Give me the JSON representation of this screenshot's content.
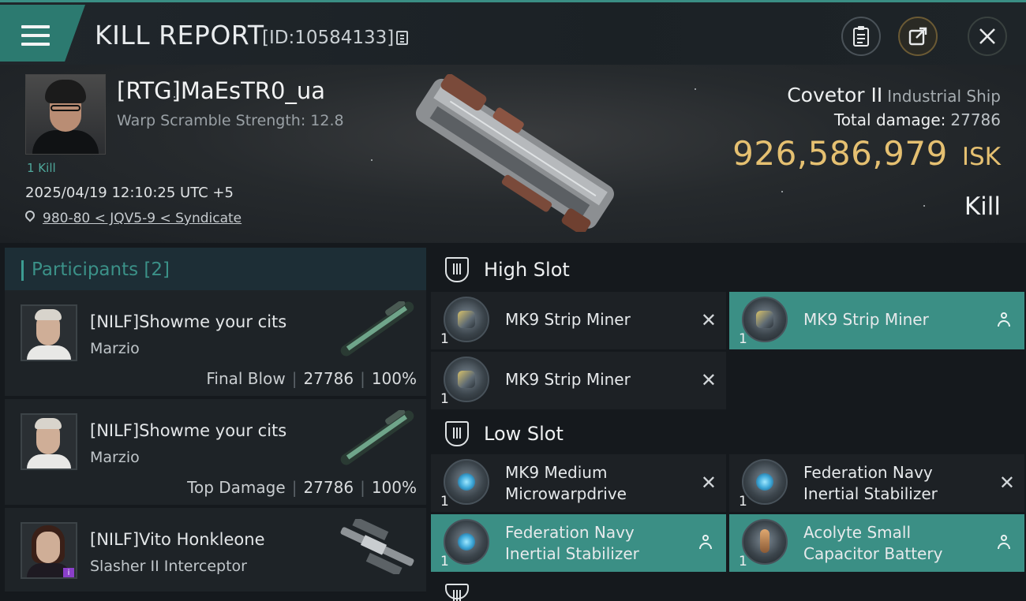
{
  "header": {
    "title": "KILL REPORT",
    "report_id": "[ID:10584133]",
    "menu_icon": "hamburger-icon",
    "buttons": [
      {
        "name": "clipboard-button",
        "icon": "clipboard-icon"
      },
      {
        "name": "share-button",
        "icon": "share-icon"
      },
      {
        "name": "close-button",
        "icon": "close-icon"
      }
    ]
  },
  "victim": {
    "pilot_name": "[RTG]MaEsTR0_ua",
    "warp_scramble": "Warp Scramble Strength: 12.8",
    "kills": "1 Kill",
    "datetime": "2025/04/19 12:10:25 UTC +5",
    "location": "980-80 < JQV5-9 < Syndicate",
    "ship_name": "Covetor II",
    "ship_class": "Industrial Ship",
    "total_damage_label": "Total damage:",
    "total_damage": "27786",
    "isk_value": "926,586,979",
    "isk_currency": "ISK",
    "result": "Kill"
  },
  "participants": {
    "header": "Participants",
    "count": "[2]",
    "rows": [
      {
        "name": "[NILF]Showme your cits",
        "sub": "Marzio",
        "label": "Final Blow",
        "damage": "27786",
        "percent": "100%"
      },
      {
        "name": "[NILF]Showme your cits",
        "sub": "Marzio",
        "label": "Top Damage",
        "damage": "27786",
        "percent": "100%"
      },
      {
        "name": "[NILF]Vito Honkleone",
        "sub": "Slasher II Interceptor",
        "badge": "i"
      }
    ]
  },
  "slots": {
    "high": {
      "title": "High Slot",
      "modules": [
        {
          "name": "MK9 Strip Miner",
          "qty": "1",
          "status": "destroyed"
        },
        {
          "name": "MK9 Strip Miner",
          "qty": "1",
          "status": "dropped"
        },
        {
          "name": "MK9 Strip Miner",
          "qty": "1",
          "status": "destroyed"
        }
      ]
    },
    "low": {
      "title": "Low Slot",
      "modules": [
        {
          "name_line1": "MK9 Medium",
          "name_line2": "Microwarpdrive",
          "qty": "1",
          "status": "destroyed"
        },
        {
          "name_line1": "Federation Navy",
          "name_line2": "Inertial Stabilizer",
          "qty": "1",
          "status": "destroyed"
        },
        {
          "name_line1": "Federation Navy",
          "name_line2": "Inertial Stabilizer",
          "qty": "1",
          "status": "dropped"
        },
        {
          "name_line1": "Acolyte Small",
          "name_line2": "Capacitor Battery",
          "qty": "1",
          "status": "dropped"
        }
      ]
    }
  },
  "colors": {
    "accent": "#3b8f85",
    "isk": "#e5c071",
    "panel": "#1d2125"
  }
}
